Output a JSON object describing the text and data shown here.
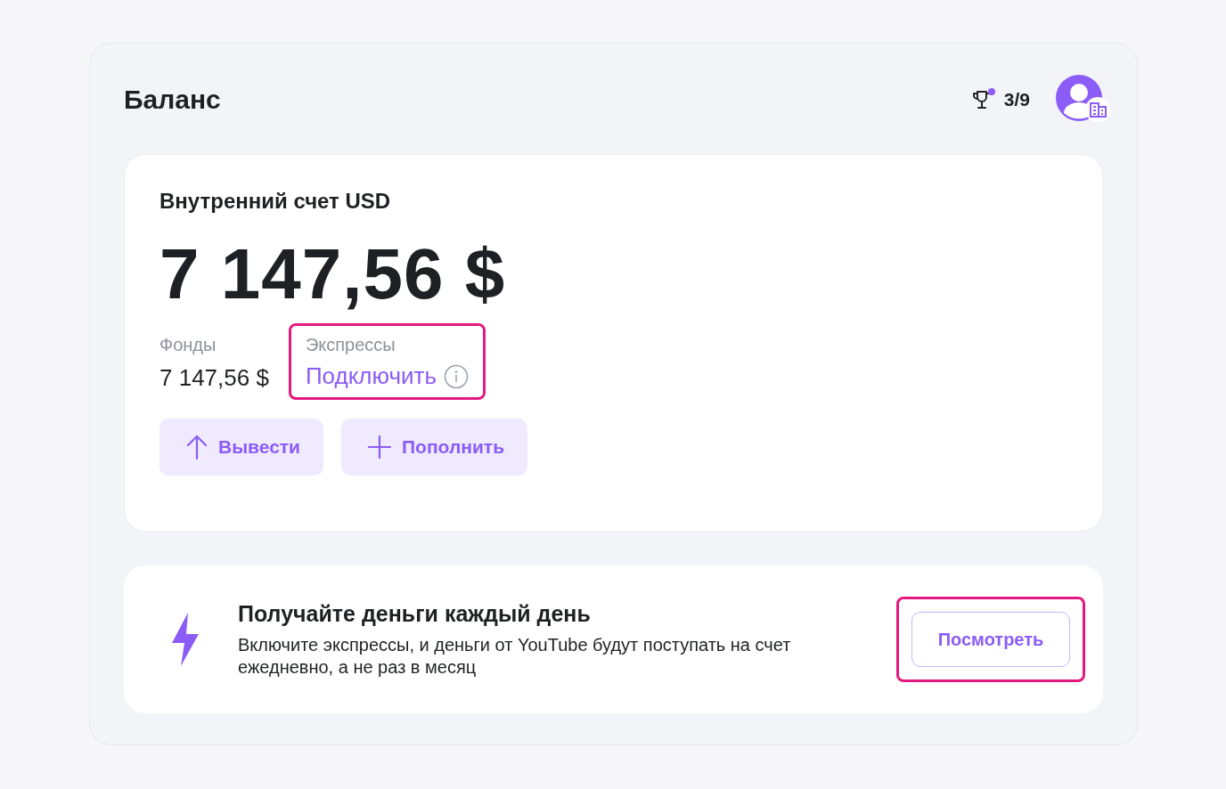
{
  "header": {
    "title": "Баланс",
    "achievements": "3/9",
    "achievements_dot": true
  },
  "account": {
    "title": "Внутренний счет USD",
    "total": "7 147,56 $",
    "funds": {
      "label": "Фонды",
      "value": "7 147,56 $"
    },
    "express": {
      "label": "Экспрессы",
      "link": "Подключить",
      "highlighted": true
    },
    "buttons": [
      {
        "kind": "withdraw",
        "label": "Вывести"
      },
      {
        "kind": "deposit",
        "label": "Пополнить"
      }
    ]
  },
  "promo": {
    "title": "Получайте деньги каждый день",
    "text": "Включите экспрессы, и деньги от YouTube будут поступать на счет ежедневно, а не раз в месяц",
    "button": "Посмотреть",
    "highlighted": true
  }
}
